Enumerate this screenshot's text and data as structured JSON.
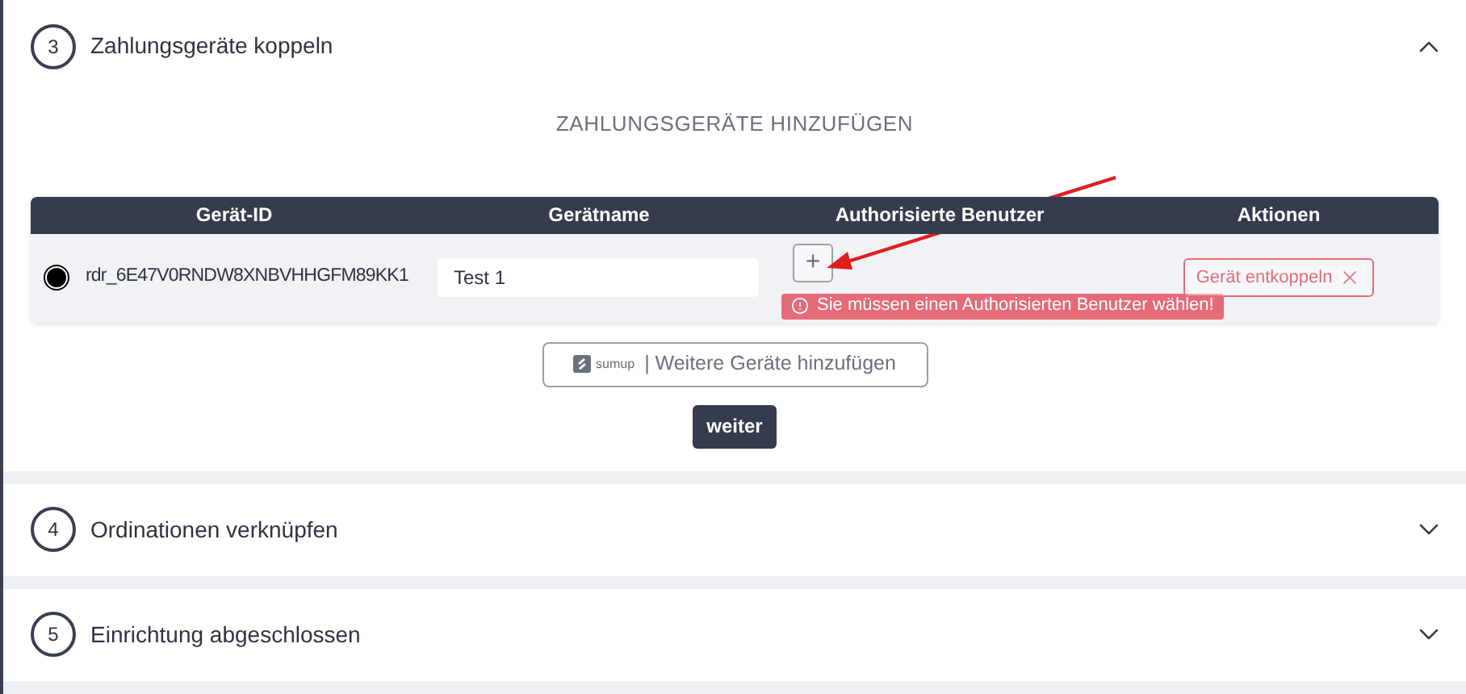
{
  "sections": [
    {
      "number": "3",
      "title": "Zahlungsgeräte koppeln",
      "expanded": true,
      "heading": "ZAHLUNGSGERÄTE HINZUFÜGEN",
      "table": {
        "columns": [
          "Gerät-ID",
          "Gerätname",
          "Authorisierte Benutzer",
          "Aktionen"
        ],
        "rows": [
          {
            "selected": true,
            "device_id": "rdr_6E47V0RNDW8XNBVHHGFM89KK1",
            "name": "Test 1",
            "add_user": "+",
            "error": "Sie müssen einen Authorisierten Benutzer wählen!",
            "action": "Gerät entkoppeln"
          }
        ]
      },
      "sumup_logo": "sumup",
      "add_more": "| Weitere Geräte hinzufügen",
      "next": "weiter"
    },
    {
      "number": "4",
      "title": "Ordinationen verknüpfen",
      "expanded": false
    },
    {
      "number": "5",
      "title": "Einrichtung abgeschlossen",
      "expanded": false
    }
  ]
}
